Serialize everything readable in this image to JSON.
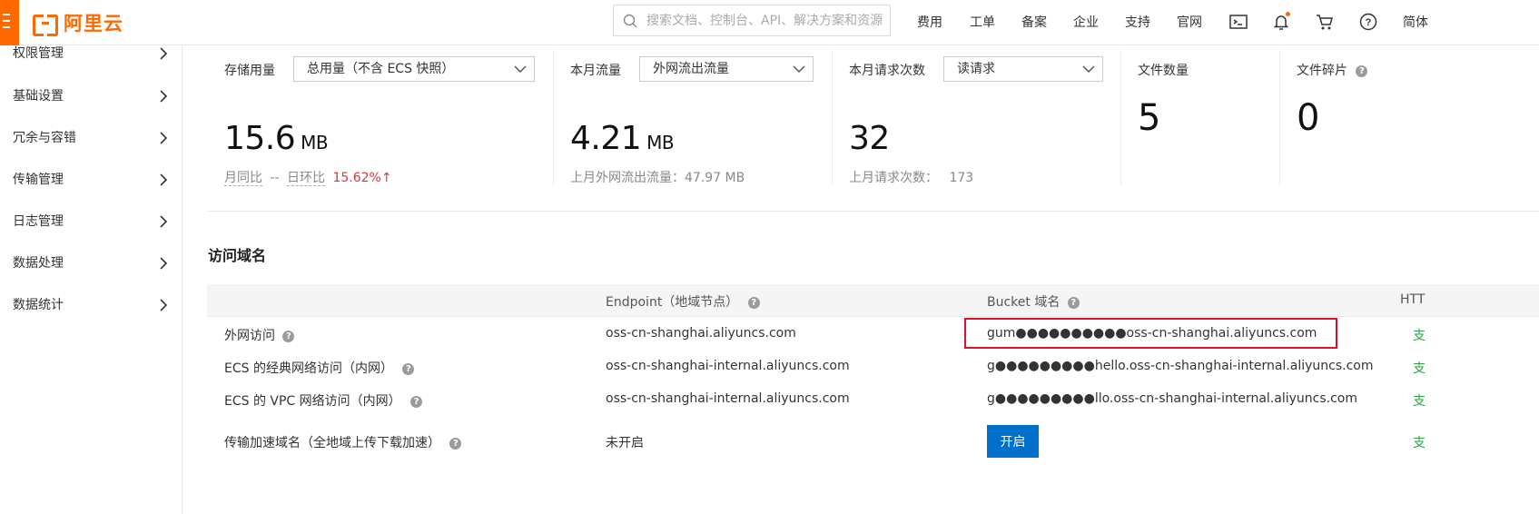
{
  "brand": {
    "name": "阿里云"
  },
  "search": {
    "placeholder": "搜索文档、控制台、API、解决方案和资源"
  },
  "nav": {
    "items": [
      "费用",
      "工单",
      "备案",
      "企业",
      "支持",
      "官网"
    ],
    "user_partial": "简体"
  },
  "sidebar": {
    "items": [
      {
        "label": "权限管理"
      },
      {
        "label": "基础设置"
      },
      {
        "label": "冗余与容错"
      },
      {
        "label": "传输管理"
      },
      {
        "label": "日志管理"
      },
      {
        "label": "数据处理"
      },
      {
        "label": "数据统计"
      }
    ]
  },
  "stats": {
    "storage": {
      "title": "存储用量",
      "select": "总用量（不含 ECS 快照）",
      "value": "15.6",
      "unit": "MB",
      "mom_label": "月同比",
      "mom_value": "--",
      "dod_label": "日环比",
      "dod_value": "15.62%",
      "dod_arrow": "↑"
    },
    "traffic": {
      "title": "本月流量",
      "select": "外网流出流量",
      "value": "4.21",
      "unit": "MB",
      "sub": "上月外网流出流量：47.97 MB"
    },
    "requests": {
      "title": "本月请求次数",
      "select": "读请求",
      "value": "32",
      "sub_label": "上月请求次数：",
      "sub_value": "173"
    },
    "files": {
      "title": "文件数量",
      "value": "5"
    },
    "fragments": {
      "title": "文件碎片",
      "value": "0"
    }
  },
  "access": {
    "title": "访问域名",
    "columns": {
      "endpoint": "Endpoint（地域节点）",
      "bucket": "Bucket 域名",
      "https": "HTT"
    },
    "rows": [
      {
        "label": "外网访问",
        "endpoint": "oss-cn-shanghai.aliyuncs.com",
        "bucket": "gum●●●●●●●●●●oss-cn-shanghai.aliyuncs.com",
        "https": "支"
      },
      {
        "label": "ECS 的经典网络访问（内网）",
        "endpoint": "oss-cn-shanghai-internal.aliyuncs.com",
        "bucket": "g●●●●●●●●●hello.oss-cn-shanghai-internal.aliyuncs.com",
        "https": "支"
      },
      {
        "label": "ECS 的 VPC 网络访问（内网）",
        "endpoint": "oss-cn-shanghai-internal.aliyuncs.com",
        "bucket": "g●●●●●●●●●llo.oss-cn-shanghai-internal.aliyuncs.com",
        "https": "支"
      },
      {
        "label": "传输加速域名（全地域上传下载加速）",
        "endpoint": "未开启",
        "button": "开启",
        "https": "支"
      }
    ]
  }
}
